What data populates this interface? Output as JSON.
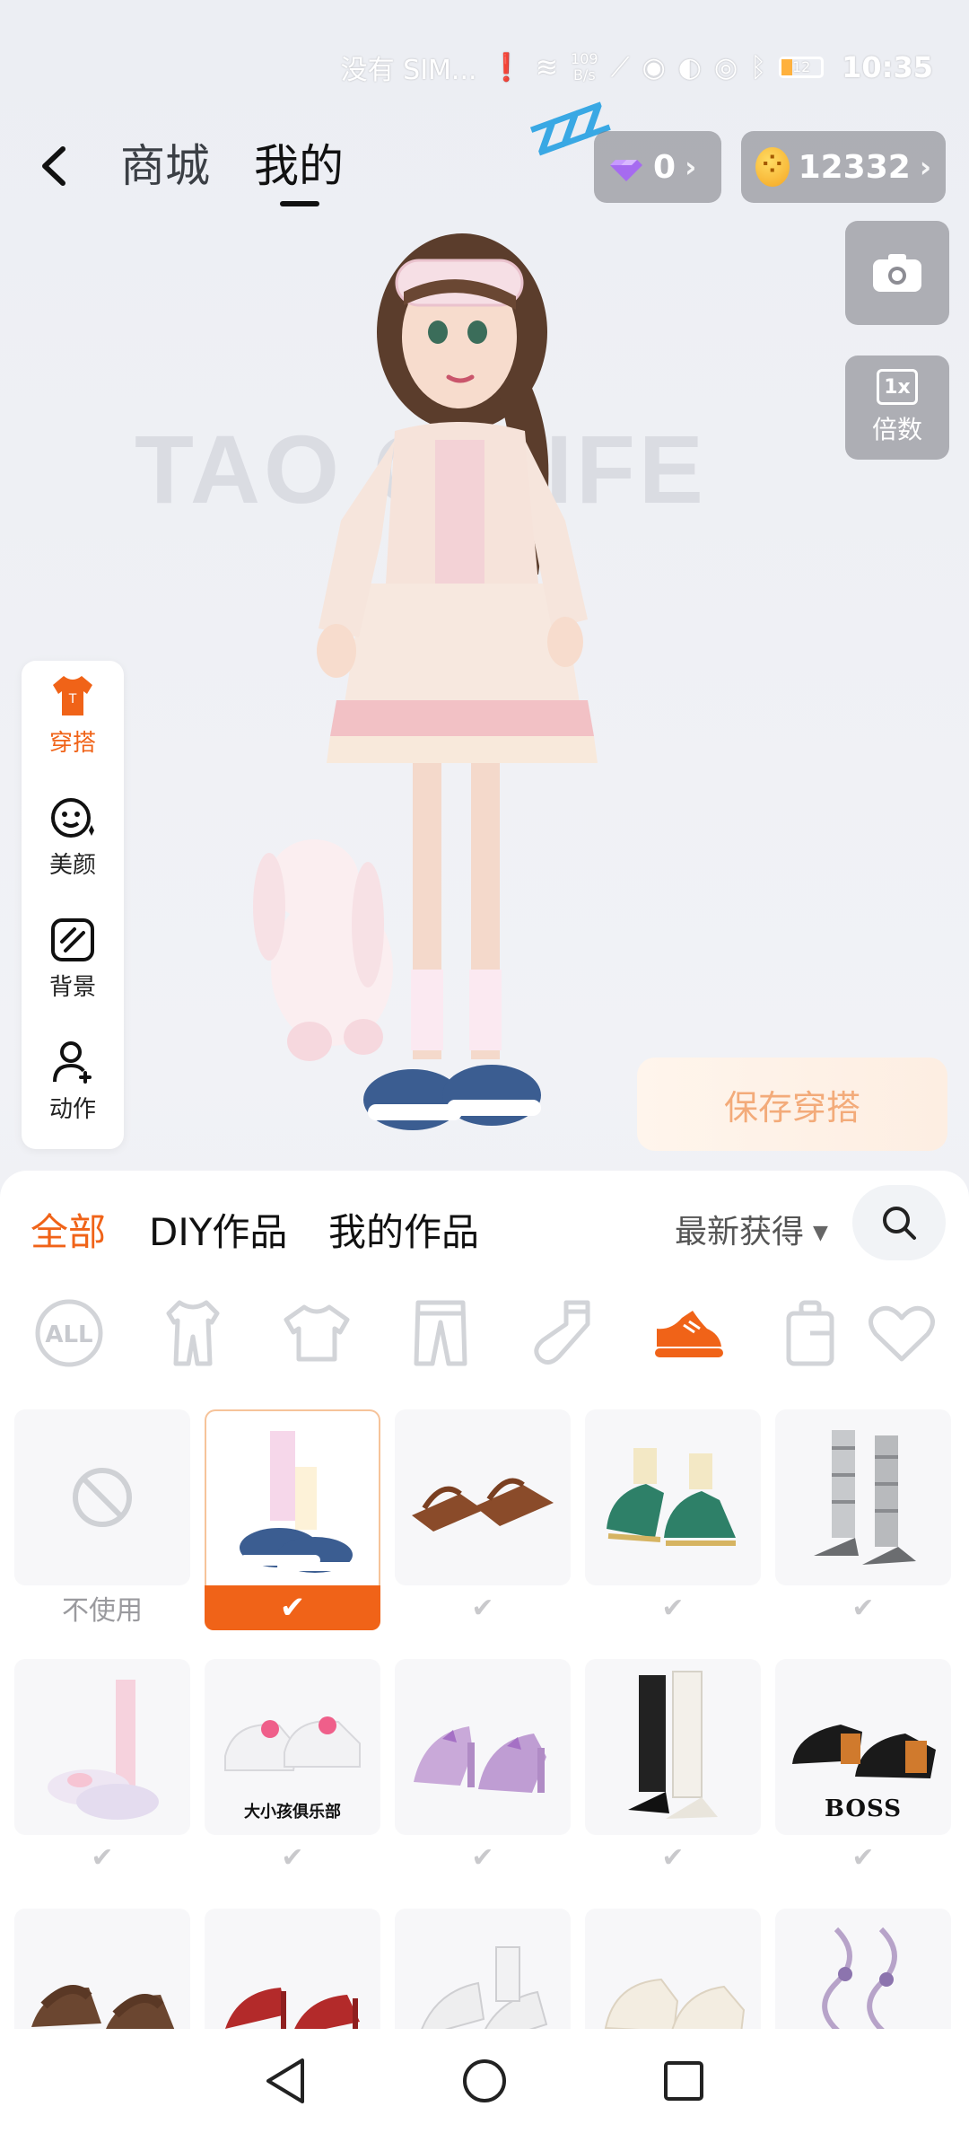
{
  "status_bar": {
    "carrier": "没有 SIM...",
    "net_speed_top": "109",
    "net_speed_bottom": "B/s",
    "battery": "12",
    "time": "10:35"
  },
  "header": {
    "tabs": [
      {
        "label": "商城",
        "active": false
      },
      {
        "label": "我的",
        "active": true
      }
    ],
    "sleep_badge": "ZZZ",
    "gems": "0",
    "coins": "12332"
  },
  "right_tools": {
    "camera_icon": "camera-icon",
    "zoom_value": "1x",
    "zoom_label": "倍数"
  },
  "stage": {
    "watermark": "TAO  O LIFE"
  },
  "left_menu": [
    {
      "label": "穿搭",
      "icon": "shirt-icon",
      "active": true
    },
    {
      "label": "美颜",
      "icon": "face-icon",
      "active": false
    },
    {
      "label": "背景",
      "icon": "background-icon",
      "active": false
    },
    {
      "label": "动作",
      "icon": "person-icon",
      "active": false
    }
  ],
  "save_button": "保存穿搭",
  "panel": {
    "tabs": [
      {
        "label": "全部",
        "active": true
      },
      {
        "label": "DIY作品",
        "active": false
      },
      {
        "label": "我的作品",
        "active": false
      }
    ],
    "sort": "最新获得",
    "categories": [
      {
        "icon": "all-icon",
        "active": false
      },
      {
        "icon": "outfit-icon",
        "active": false
      },
      {
        "icon": "top-icon",
        "active": false
      },
      {
        "icon": "pants-icon",
        "active": false
      },
      {
        "icon": "socks-icon",
        "active": false
      },
      {
        "icon": "shoes-icon",
        "active": true
      },
      {
        "icon": "bag-icon",
        "active": false
      },
      {
        "icon": "heart-icon",
        "active": false
      }
    ],
    "items": [
      {
        "name": "none",
        "caption": "不使用"
      },
      {
        "name": "fluffy-sneakers",
        "selected": true
      },
      {
        "name": "brown-sandals"
      },
      {
        "name": "green-shoes"
      },
      {
        "name": "silver-boots"
      },
      {
        "name": "pink-slippers"
      },
      {
        "name": "white-sneakers",
        "brand": "大小孩俱乐部"
      },
      {
        "name": "lilac-heels"
      },
      {
        "name": "white-knee-boots"
      },
      {
        "name": "black-oxfords",
        "brand": "BOSS"
      },
      {
        "name": "brown-strap-sandals"
      },
      {
        "name": "red-heels"
      },
      {
        "name": "white-heels"
      },
      {
        "name": "cream-boots"
      },
      {
        "name": "purple-ribbon-shoes"
      }
    ]
  },
  "colors": {
    "accent": "#f06318",
    "save_text": "#f3ab7a",
    "pill_bg": "#78787f"
  }
}
